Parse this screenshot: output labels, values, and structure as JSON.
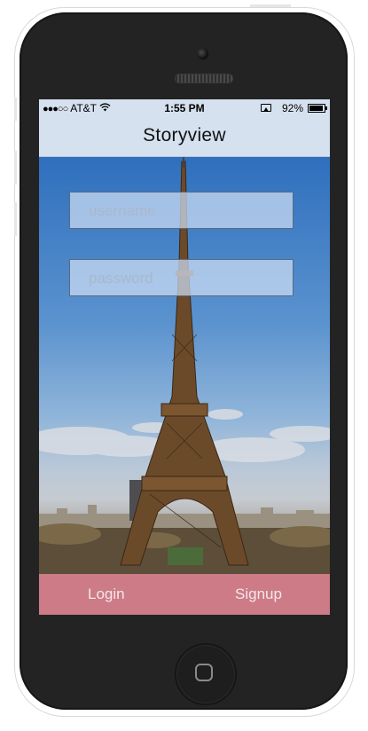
{
  "status_bar": {
    "signal_dots": "●●●○○",
    "carrier": "AT&T",
    "wifi_icon": "wifi-icon",
    "time": "1:55 PM",
    "battery_percent": "92%"
  },
  "nav": {
    "title": "Storyview"
  },
  "form": {
    "username_placeholder": "username",
    "password_placeholder": "password"
  },
  "bottom_bar": {
    "login_label": "Login",
    "signup_label": "Signup",
    "color": "#cc7b87"
  },
  "colors": {
    "nav_background": "#d6e1ef",
    "phone_body": "#232323"
  }
}
